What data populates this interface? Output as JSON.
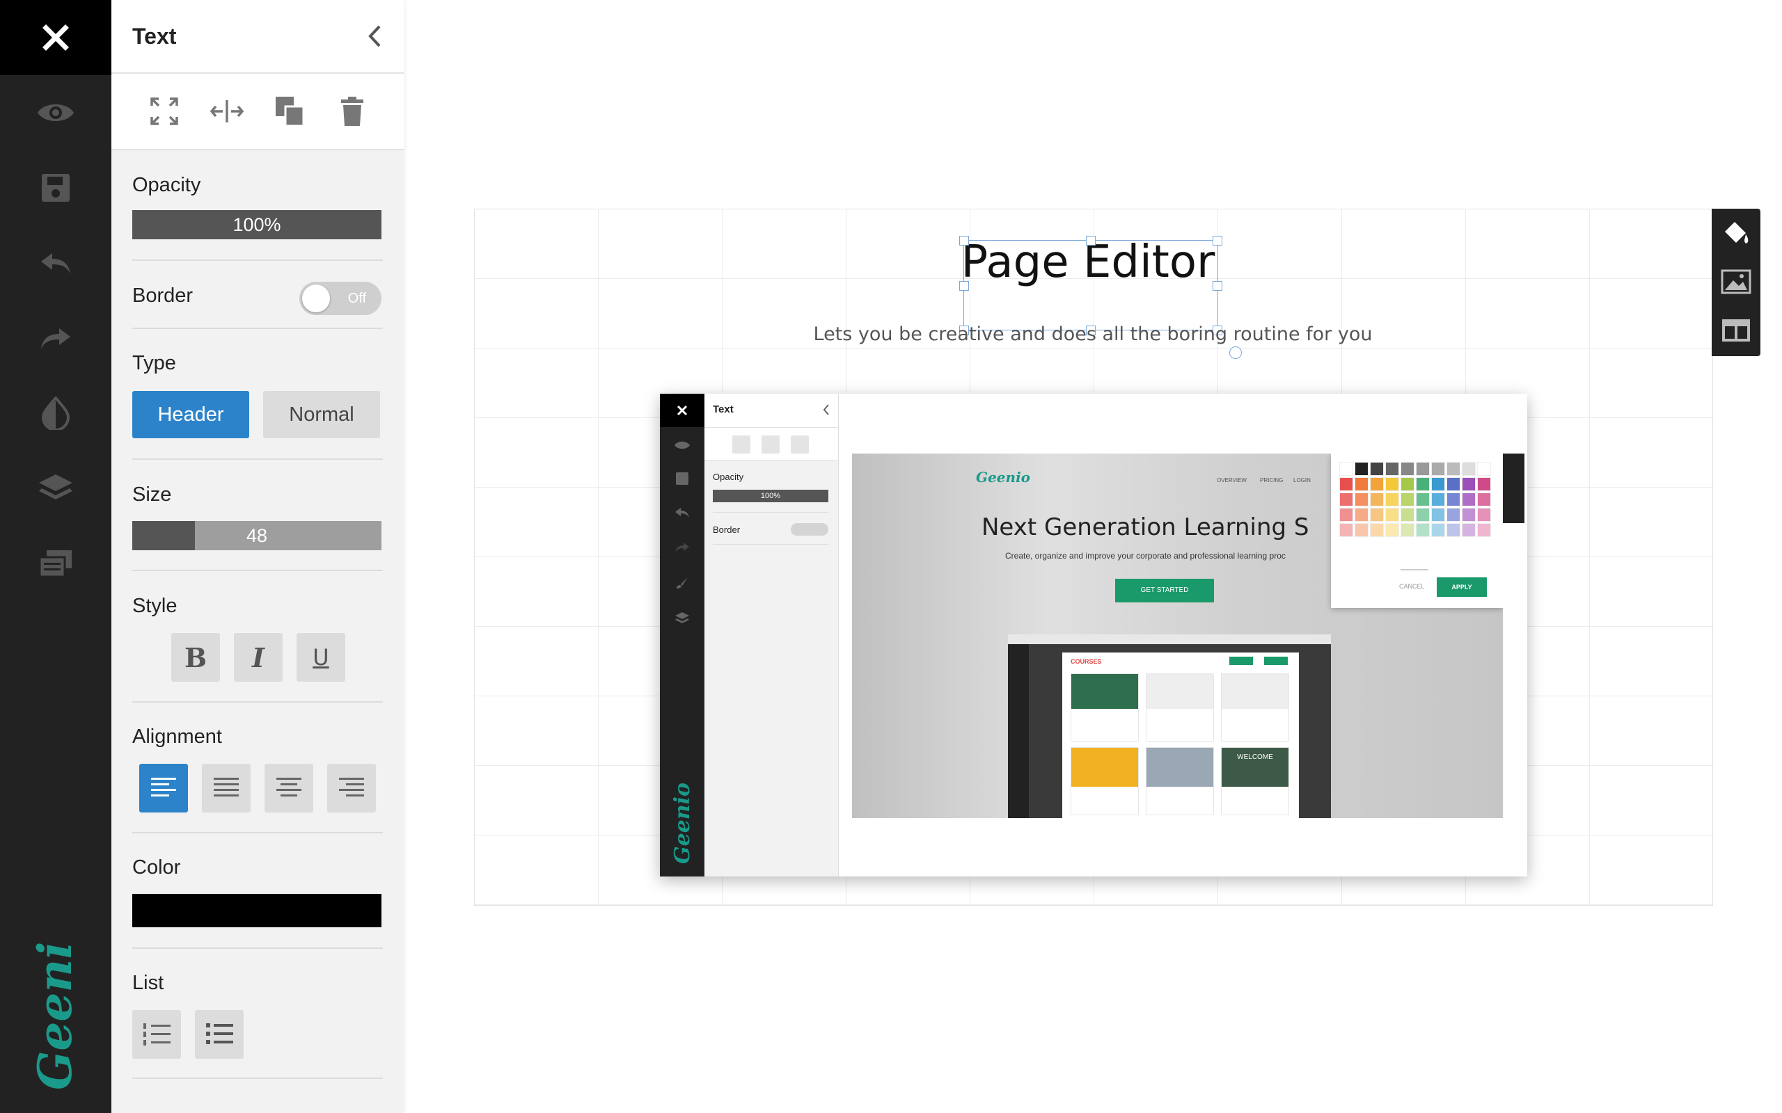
{
  "rail": {
    "close_icon": "close-icon",
    "tools": [
      "eye-icon",
      "save-icon",
      "undo-icon",
      "redo-icon",
      "contrast-icon",
      "layers-icon",
      "cards-icon"
    ],
    "brand": "Geenio"
  },
  "panel": {
    "title": "Text",
    "opacity": {
      "label": "Opacity",
      "value_text": "100%",
      "value": 1.0
    },
    "border": {
      "label": "Border",
      "state": "Off"
    },
    "type": {
      "label": "Type",
      "options": [
        "Header",
        "Normal"
      ],
      "selected": "Header"
    },
    "size": {
      "label": "Size",
      "value_text": "48",
      "fraction": 0.25
    },
    "style": {
      "label": "Style",
      "bold": "B",
      "italic": "I",
      "underline": "U"
    },
    "alignment": {
      "label": "Alignment",
      "selected": "left"
    },
    "color": {
      "label": "Color",
      "value": "#000000"
    },
    "list": {
      "label": "List"
    }
  },
  "canvas": {
    "headline": "Page Editor",
    "subtitle": "Lets you be creative and does all the boring routine for you"
  },
  "preview": {
    "panel_title": "Text",
    "opacity_label": "Opacity",
    "opacity_value": "100%",
    "border_label": "Border",
    "brand": "Geenio",
    "nav": [
      "OVERVIEW",
      "PRICING",
      "LOGIN"
    ],
    "hero_title": "Next Generation Learning Syst",
    "hero_sub": "Create, organize and improve your corporate and professional learning proc",
    "cta": "GET STARTED",
    "cancel": "CANCEL",
    "apply": "APPLY",
    "courses_tab": "COURSES",
    "welcome_text": "WELCOME"
  },
  "colors": {
    "accent": "#2d83c9",
    "brand_teal": "#1a9a8a",
    "rail": "#222222"
  }
}
